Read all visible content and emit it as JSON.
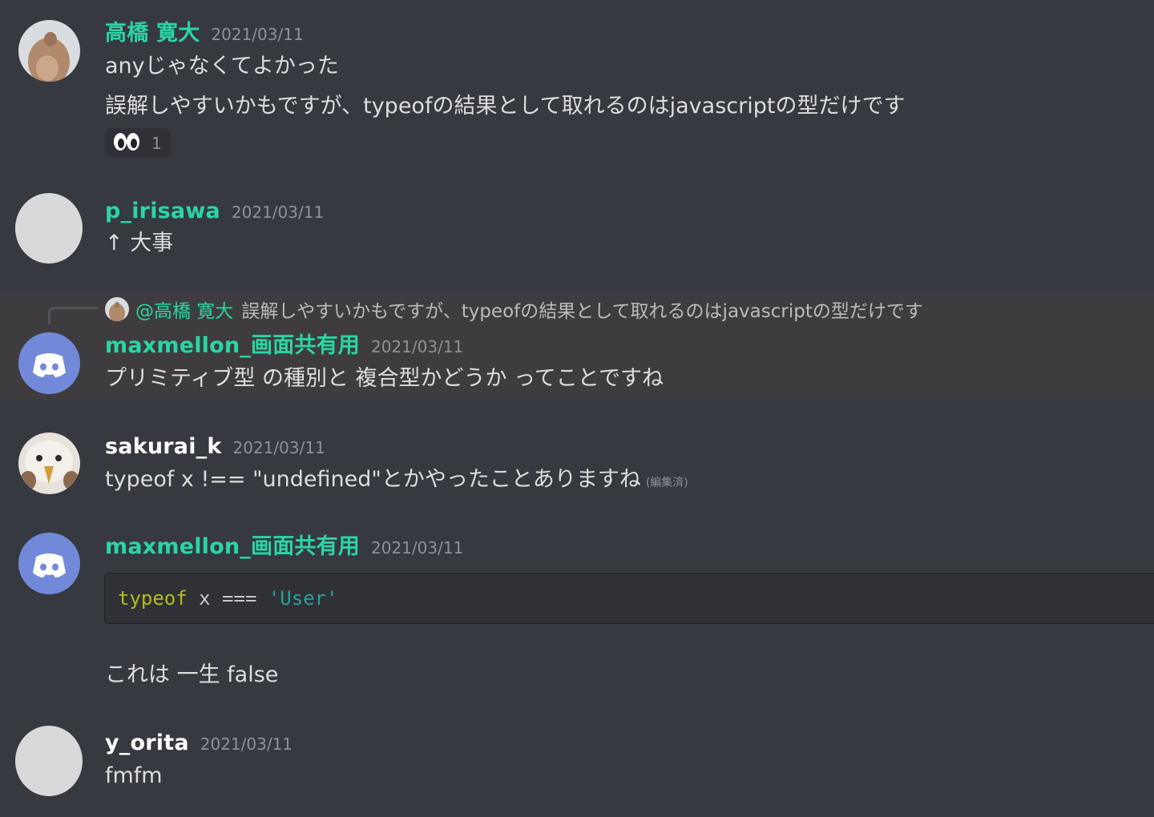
{
  "colors": {
    "background": "#36393f",
    "username_green": "#2bd5a4",
    "highlight": "#3e3c3e",
    "discord_blurple": "#7289da"
  },
  "messages": [
    {
      "username": "高橋 寛大",
      "timestamp": "2021/03/11",
      "lines": [
        "anyじゃなくてよかった",
        "誤解しやすいかもですが、typeofの結果として取れるのはjavascriptの型だけです"
      ],
      "reaction": {
        "emoji": "eyes-emoji",
        "count": "1"
      }
    },
    {
      "username": "p_irisawa",
      "timestamp": "2021/03/11",
      "lines": [
        "↑ 大事"
      ]
    },
    {
      "reply": {
        "mention": "@高橋 寛大",
        "preview": "誤解しやすいかもですが、typeofの結果として取れるのはjavascriptの型だけです"
      },
      "username": "maxmellon_画面共有用",
      "timestamp": "2021/03/11",
      "lines": [
        "プリミティブ型 の種別と 複合型かどうか ってことですね"
      ]
    },
    {
      "username": "sakurai_k",
      "timestamp": "2021/03/11",
      "lines": [
        "typeof x !== \"undefined\"とかやったことありますね"
      ],
      "edited": "(編集済)"
    },
    {
      "username": "maxmellon_画面共有用",
      "timestamp": "2021/03/11",
      "code": {
        "keyword": "typeof",
        "middle": " x === ",
        "string": "'User'"
      },
      "after_code": "これは 一生 false"
    },
    {
      "username": "y_orita",
      "timestamp": "2021/03/11",
      "lines": [
        "fmfm"
      ]
    }
  ]
}
